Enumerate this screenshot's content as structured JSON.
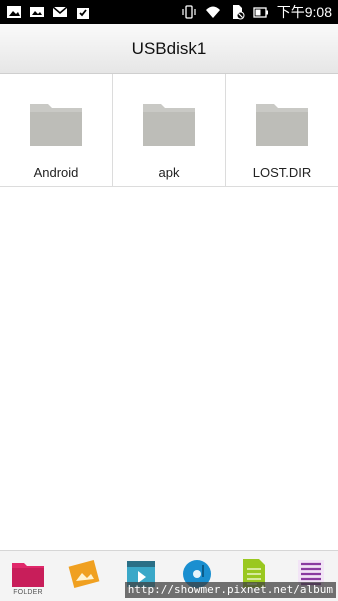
{
  "status_bar": {
    "time": "下午9:08",
    "left_icons": [
      "image-icon",
      "photo-icon",
      "mail-icon",
      "download-icon"
    ],
    "right_icons": [
      "vibrate-icon",
      "wifi-icon",
      "no-sim-icon",
      "battery-icon"
    ]
  },
  "header": {
    "title": "USBdisk1"
  },
  "folders": [
    {
      "name": "Android"
    },
    {
      "name": "apk"
    },
    {
      "name": "LOST.DIR"
    }
  ],
  "bottom_tabs": [
    {
      "label": "FOLDER",
      "icon": "folder-icon",
      "color": "#e0286a"
    },
    {
      "label": "",
      "icon": "picture-icon",
      "color": "#f0a020"
    },
    {
      "label": "",
      "icon": "video-icon",
      "color": "#3aa8c8"
    },
    {
      "label": "",
      "icon": "music-icon",
      "color": "#1a8fd0"
    },
    {
      "label": "",
      "icon": "document-icon",
      "color": "#9ac820"
    },
    {
      "label": "",
      "icon": "list-icon",
      "color": "#8a3aa0"
    }
  ],
  "watermark": "http://showmer.pixnet.net/album"
}
